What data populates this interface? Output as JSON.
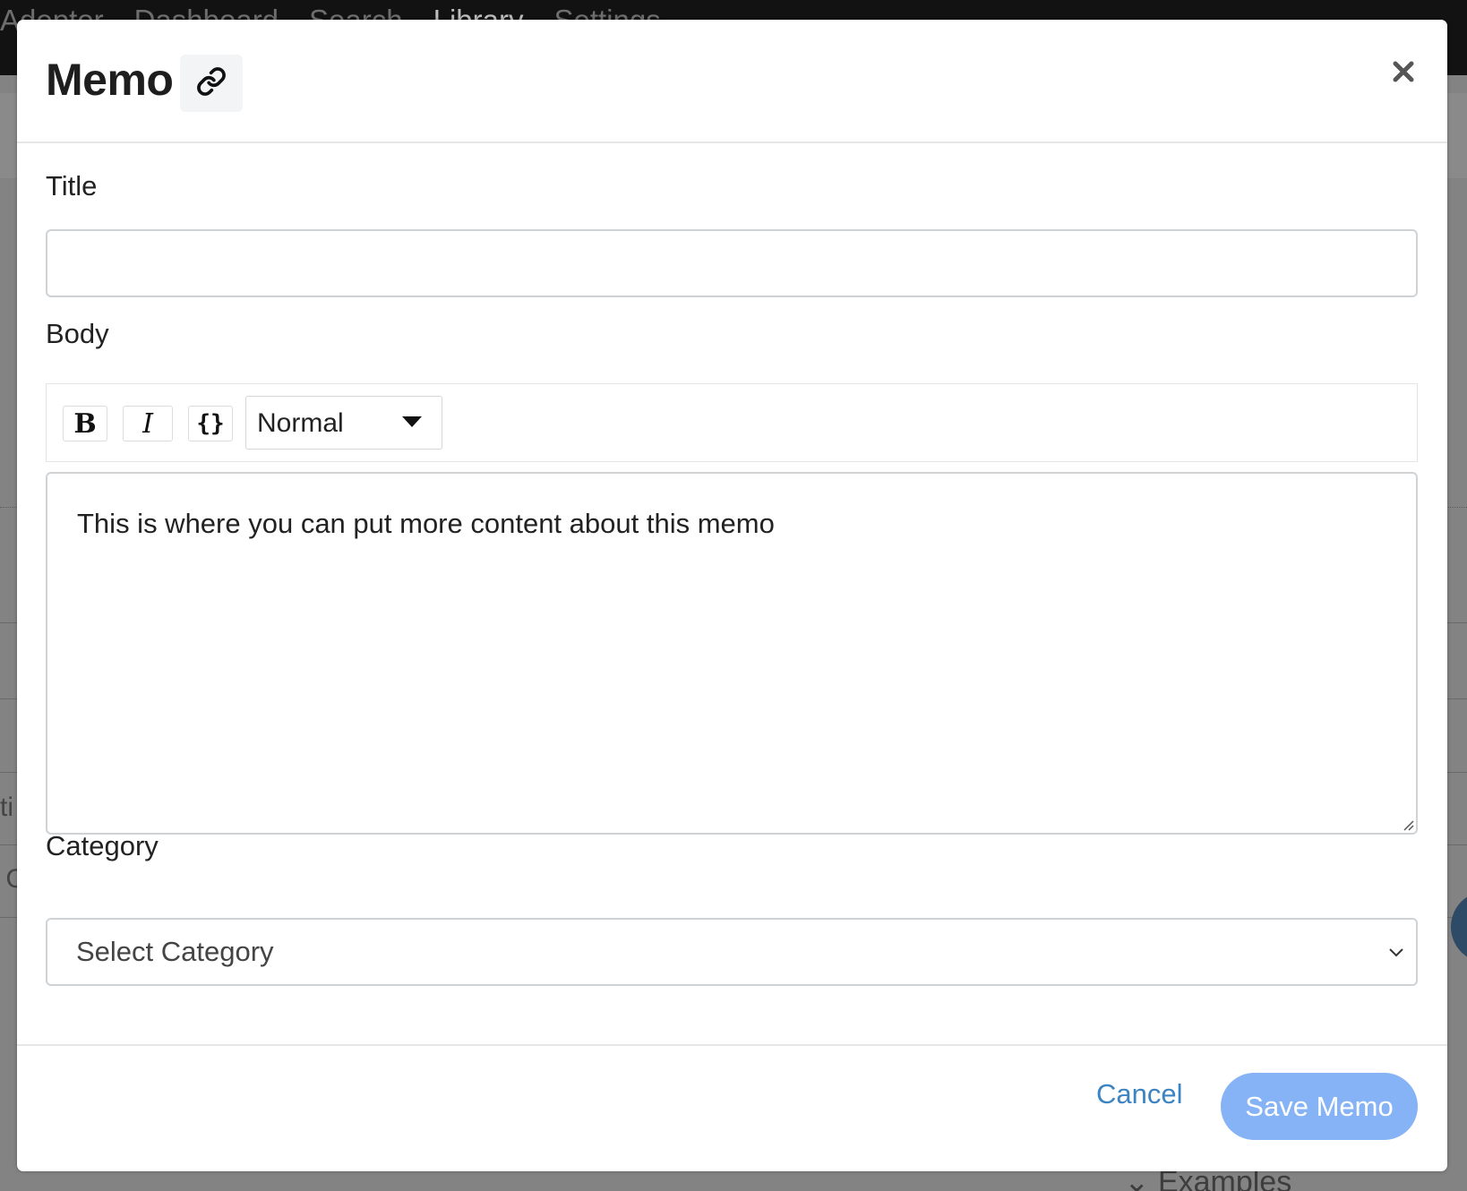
{
  "background": {
    "nav_items": [
      "Adeptor",
      "Dashboard",
      "Search",
      "Library",
      "Settings"
    ],
    "fragments": [
      "ti",
      "r C"
    ],
    "examples_label": "Examples"
  },
  "modal": {
    "title": "Memo",
    "link_icon": "link-icon",
    "close_label": "×",
    "fields": {
      "title_label": "Title",
      "title_value": "",
      "body_label": "Body",
      "toolbar": {
        "bold_label": "B",
        "italic_label": "I",
        "code_label": "{}",
        "format_value": "Normal"
      },
      "body_text": "This is where you can put more content about this memo",
      "category_label": "Category",
      "category_value": "Select Category"
    },
    "footer": {
      "cancel_label": "Cancel",
      "save_label": "Save Memo"
    }
  },
  "colors": {
    "accent_link": "#3a84c4",
    "save_button": "#86b3f5",
    "overlay": "#7a7a7a"
  }
}
